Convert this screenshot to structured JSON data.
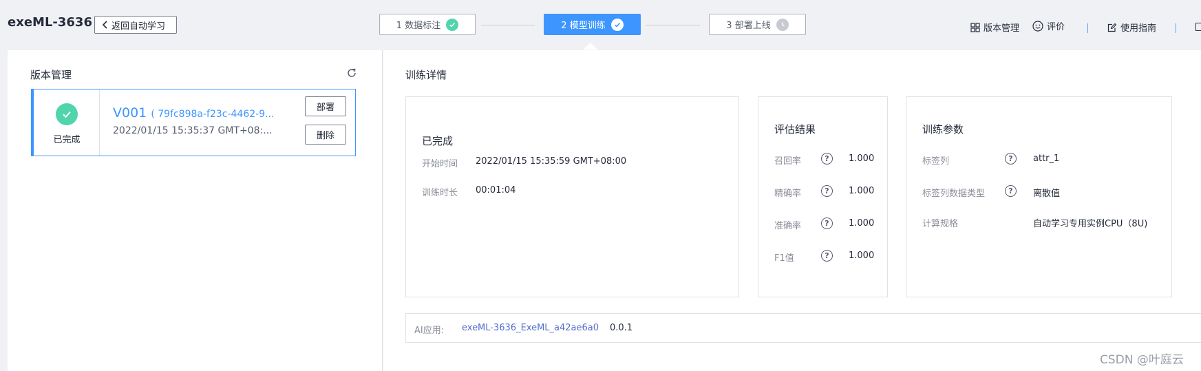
{
  "header": {
    "app_title": "exeML-3636",
    "back_label": "返回自动学习",
    "steps": [
      {
        "label": "1 数据标注",
        "state": "done"
      },
      {
        "label": "2 模型训练",
        "state": "active"
      },
      {
        "label": "3 部署上线",
        "state": "pending"
      }
    ],
    "links": {
      "version_mgmt": "版本管理",
      "rate": "评价",
      "guide": "使用指南"
    }
  },
  "left": {
    "title": "版本管理",
    "version": {
      "status": "已完成",
      "name": "V001",
      "id": "( 79fc898a-f23c-4462-9...",
      "time": "2022/01/15 15:35:37 GMT+08:...",
      "deploy_label": "部署",
      "delete_label": "删除"
    }
  },
  "detail": {
    "title": "训练详情",
    "status_card": {
      "status": "已完成",
      "start_label": "开始时间",
      "start_value": "2022/01/15 15:35:59 GMT+08:00",
      "duration_label": "训练时长",
      "duration_value": "00:01:04"
    },
    "eval_card": {
      "title": "评估结果",
      "rows": [
        {
          "label": "召回率",
          "value": "1.000"
        },
        {
          "label": "精确率",
          "value": "1.000"
        },
        {
          "label": "准确率",
          "value": "1.000"
        },
        {
          "label": "F1值",
          "value": "1.000"
        }
      ]
    },
    "params_card": {
      "title": "训练参数",
      "rows": [
        {
          "label": "标签列",
          "value": "attr_1"
        },
        {
          "label": "标签列数据类型",
          "value": "离散值"
        },
        {
          "label": "计算规格",
          "value": "自动学习专用实例CPU（8U)"
        }
      ]
    },
    "ai_app": {
      "label": "AI应用:",
      "name": "exeML-3636_ExeML_a42ae6a0",
      "version": "0.0.1"
    }
  },
  "watermark": "CSDN @叶庭云",
  "colors": {
    "accent": "#3d96ff",
    "success": "#50d4ab",
    "link": "#526ecc",
    "pending": "#c7cad1"
  }
}
